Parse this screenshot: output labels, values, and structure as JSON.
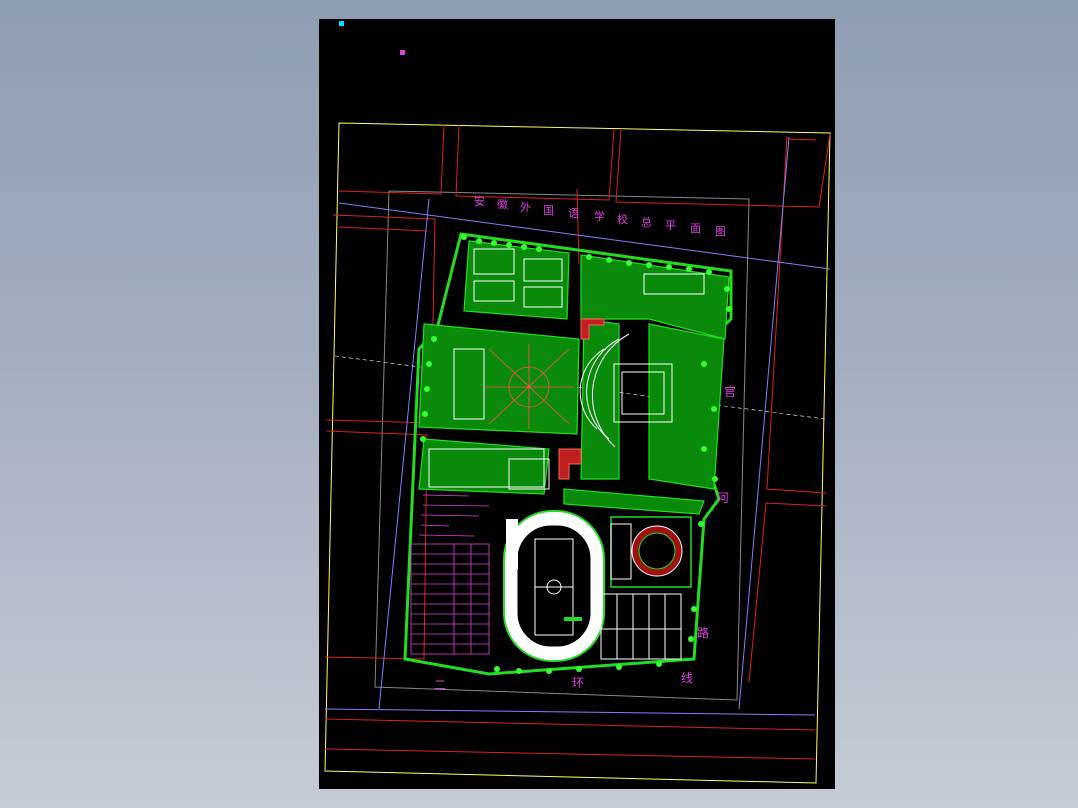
{
  "drawing": {
    "title": "安徽外国语学校总平面图",
    "title_chars": [
      "安",
      "徽",
      "外",
      "国",
      "语",
      "学",
      "校",
      "总",
      "平",
      "面",
      "图"
    ],
    "road_east_chars": [
      "官",
      "河",
      "路"
    ],
    "road_south_chars": [
      "二",
      "环",
      "线"
    ]
  },
  "colors": {
    "background": "#000000",
    "boundary": "#ffff66",
    "roads": "#e02020",
    "axis": "#8080ff",
    "vegetation": "#22dd22",
    "labels": "#e040e0",
    "lines": "#ffffff"
  },
  "icons": {
    "ucs_marker": "cyan-square-icon",
    "base_point_marker": "magenta-square-icon"
  }
}
